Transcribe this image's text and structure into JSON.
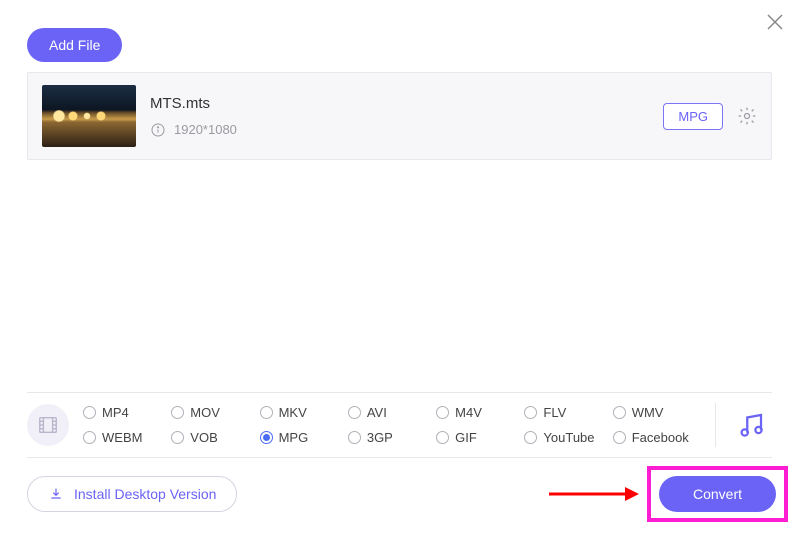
{
  "close_icon": "close",
  "toolbar": {
    "add_file_label": "Add File"
  },
  "file": {
    "name": "MTS.mts",
    "dimensions": "1920*1080",
    "format_badge": "MPG"
  },
  "formats": {
    "options": [
      {
        "id": "mp4",
        "label": "MP4",
        "selected": false
      },
      {
        "id": "mov",
        "label": "MOV",
        "selected": false
      },
      {
        "id": "mkv",
        "label": "MKV",
        "selected": false
      },
      {
        "id": "avi",
        "label": "AVI",
        "selected": false
      },
      {
        "id": "m4v",
        "label": "M4V",
        "selected": false
      },
      {
        "id": "flv",
        "label": "FLV",
        "selected": false
      },
      {
        "id": "wmv",
        "label": "WMV",
        "selected": false
      },
      {
        "id": "webm",
        "label": "WEBM",
        "selected": false
      },
      {
        "id": "vob",
        "label": "VOB",
        "selected": false
      },
      {
        "id": "mpg",
        "label": "MPG",
        "selected": true
      },
      {
        "id": "3gp",
        "label": "3GP",
        "selected": false
      },
      {
        "id": "gif",
        "label": "GIF",
        "selected": false
      },
      {
        "id": "youtube",
        "label": "YouTube",
        "selected": false
      },
      {
        "id": "facebook",
        "label": "Facebook",
        "selected": false
      }
    ]
  },
  "bottom": {
    "install_label": "Install Desktop Version",
    "convert_label": "Convert"
  },
  "annotation": {
    "arrow_color": "#ff0000",
    "highlight_color": "#ff1dd4"
  }
}
